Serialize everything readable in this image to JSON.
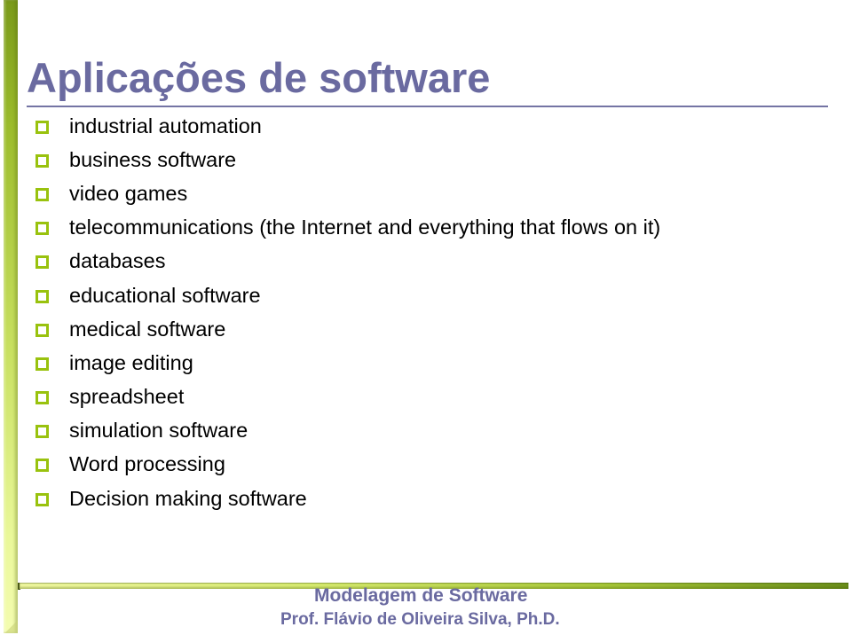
{
  "slide": {
    "title": "Aplicações de software",
    "items": [
      "industrial automation",
      "business software",
      "video games",
      "telecommunications (the Internet and everything that flows on it)",
      "databases",
      "educational software",
      "medical software",
      "image editing",
      "spreadsheet",
      "simulation software",
      "Word processing",
      "Decision making software"
    ],
    "bullet_icon": "hollow-square-bullet",
    "colors": {
      "title": "#6a6aa0",
      "bullet": "#99c20e",
      "accent_bar": "#9cbc2c"
    }
  },
  "footer": {
    "course": "Modelagem de Software",
    "professor": "Prof. Flávio de Oliveira Silva, Ph.D."
  }
}
